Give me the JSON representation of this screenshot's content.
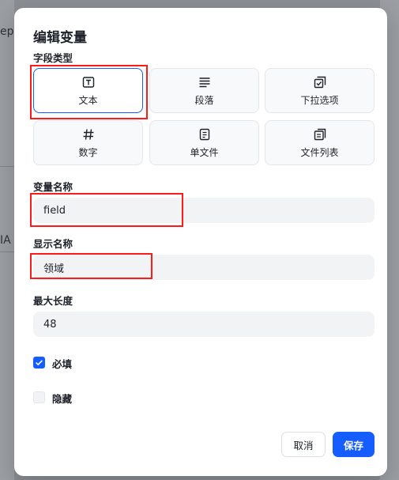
{
  "background": {
    "left_snippet": "ep",
    "left_snippet2": "IA"
  },
  "dialog": {
    "title": "编辑变量",
    "field_type_label": "字段类型",
    "field_types": [
      {
        "label": "文本",
        "icon": "text-box-icon",
        "selected": true
      },
      {
        "label": "段落",
        "icon": "paragraph-lines-icon",
        "selected": false
      },
      {
        "label": "下拉选项",
        "icon": "dropdown-check-icon",
        "selected": false
      },
      {
        "label": "数字",
        "icon": "hash-icon",
        "selected": false
      },
      {
        "label": "单文件",
        "icon": "file-icon",
        "selected": false
      },
      {
        "label": "文件列表",
        "icon": "file-list-icon",
        "selected": false
      }
    ],
    "variable_name_label": "变量名称",
    "variable_name_value": "field",
    "display_name_label": "显示名称",
    "display_name_value": "领域",
    "max_length_label": "最大长度",
    "max_length_value": "48",
    "required_label": "必填",
    "required_checked": true,
    "hidden_label": "隐藏",
    "hidden_checked": false,
    "cancel_label": "取消",
    "save_label": "保存"
  },
  "colors": {
    "accent": "#165dff",
    "highlight": "#ff1a1a",
    "input_bg": "#f2f3f5",
    "overlay": "#8a8d92"
  }
}
